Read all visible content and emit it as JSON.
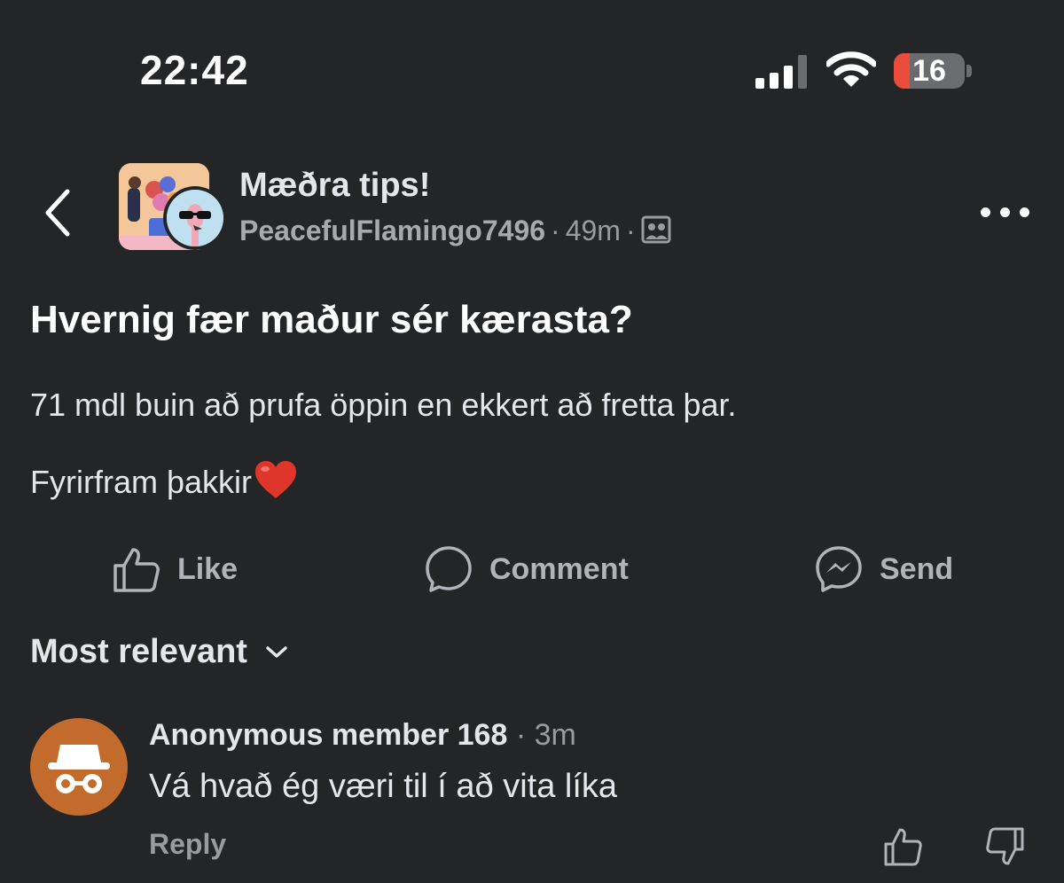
{
  "status_bar": {
    "time": "22:42",
    "battery_level": "16",
    "icons": [
      "cellular-signal-icon",
      "wifi-icon",
      "battery-icon"
    ]
  },
  "header": {
    "group_name": "Mæðra tips!",
    "author": "PeacefulFlamingo7496",
    "separator": "·",
    "time_ago": "49m",
    "icons": [
      "back-chevron-icon",
      "group-icon",
      "more-options-icon"
    ]
  },
  "post": {
    "title": "Hvernig fær maður sér kærasta?",
    "body": "71 mdl buin að prufa öppin en ekkert að fretta þar.",
    "sign_off": "Fyrirfram þakkir",
    "emoji": "red-heart-icon"
  },
  "actions": {
    "like": "Like",
    "comment": "Comment",
    "send": "Send"
  },
  "sort": {
    "label": "Most relevant"
  },
  "comment": {
    "author": "Anonymous member 168",
    "separator": "·",
    "time_ago": "3m",
    "text": "Vá hvað ég væri til í að vita líka",
    "reply": "Reply"
  },
  "colors": {
    "background": "#242526",
    "text_primary": "#e4e6eb",
    "text_secondary": "#b0b3b8",
    "anonymous_avatar": "#c36a2d",
    "battery_low": "#eb4d3d"
  }
}
